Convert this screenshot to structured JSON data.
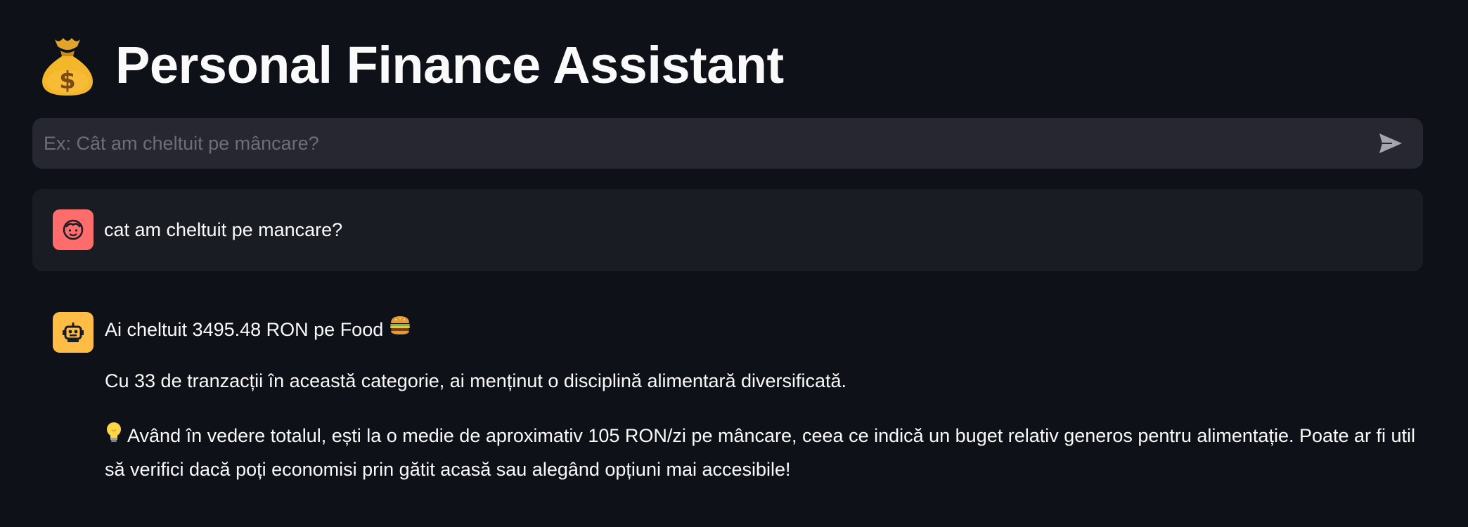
{
  "app": {
    "title": "Personal Finance Assistant",
    "title_icon": "money-bag-icon"
  },
  "chat_input": {
    "placeholder": "Ex: Cât am cheltuit pe mâncare?",
    "value": "",
    "send_icon": "send-icon"
  },
  "messages": [
    {
      "role": "user",
      "avatar_icon": "user-face-icon",
      "avatar_color": "#ff6c6c",
      "text": "cat am cheltuit pe mancare?"
    },
    {
      "role": "assistant",
      "avatar_icon": "robot-icon",
      "avatar_color": "#ffbd45",
      "line1": "Ai cheltuit 3495.48 RON pe Food",
      "line1_emoji": "hamburger-icon",
      "line2": "Cu 33 de tranzacții în această categorie, ai menținut o disciplină alimentară diversificată.",
      "tip_emoji": "light-bulb-icon",
      "tip": "Având în vedere totalul, ești la o medie de aproximativ 105 RON/zi pe mâncare, ceea ce indică un buget relativ generos pentru alimentație. Poate ar fi util să verifici dacă poți economisi prin gătit acasă sau alegând opțiuni mai accesibile!"
    }
  ],
  "colors": {
    "background": "#0e1117",
    "input_bg": "#262730",
    "user_msg_bg": "#1a1c24",
    "text": "#fafafa"
  }
}
